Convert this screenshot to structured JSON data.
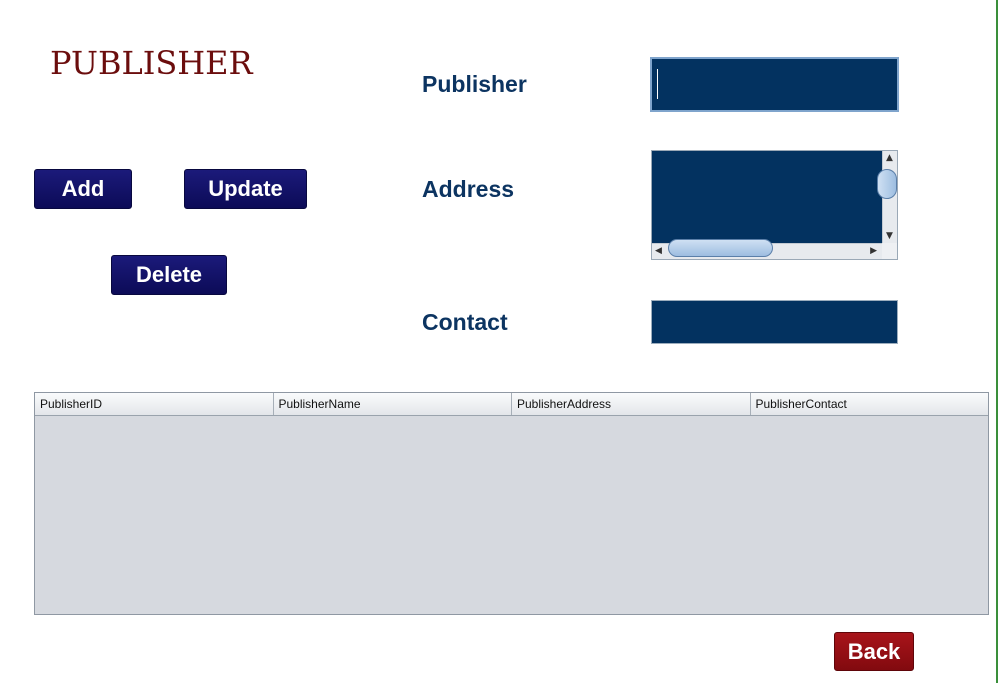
{
  "title": "PUBLISHER",
  "buttons": {
    "add": "Add",
    "update": "Update",
    "delete": "Delete",
    "back": "Back"
  },
  "form": {
    "publisher_label": "Publisher",
    "publisher_value": "",
    "address_label": "Address",
    "address_value": "",
    "contact_label": "Contact",
    "contact_value": ""
  },
  "table": {
    "columns": [
      "PublisherID",
      "PublisherName",
      "PublisherAddress",
      "PublisherContact"
    ],
    "rows": []
  },
  "colors": {
    "title": "#6b0d0d",
    "button_navy": "#0c0b57",
    "button_back": "#960f14",
    "label": "#0c3461",
    "field_bg": "#033260",
    "table_bg": "#d6d9df"
  }
}
